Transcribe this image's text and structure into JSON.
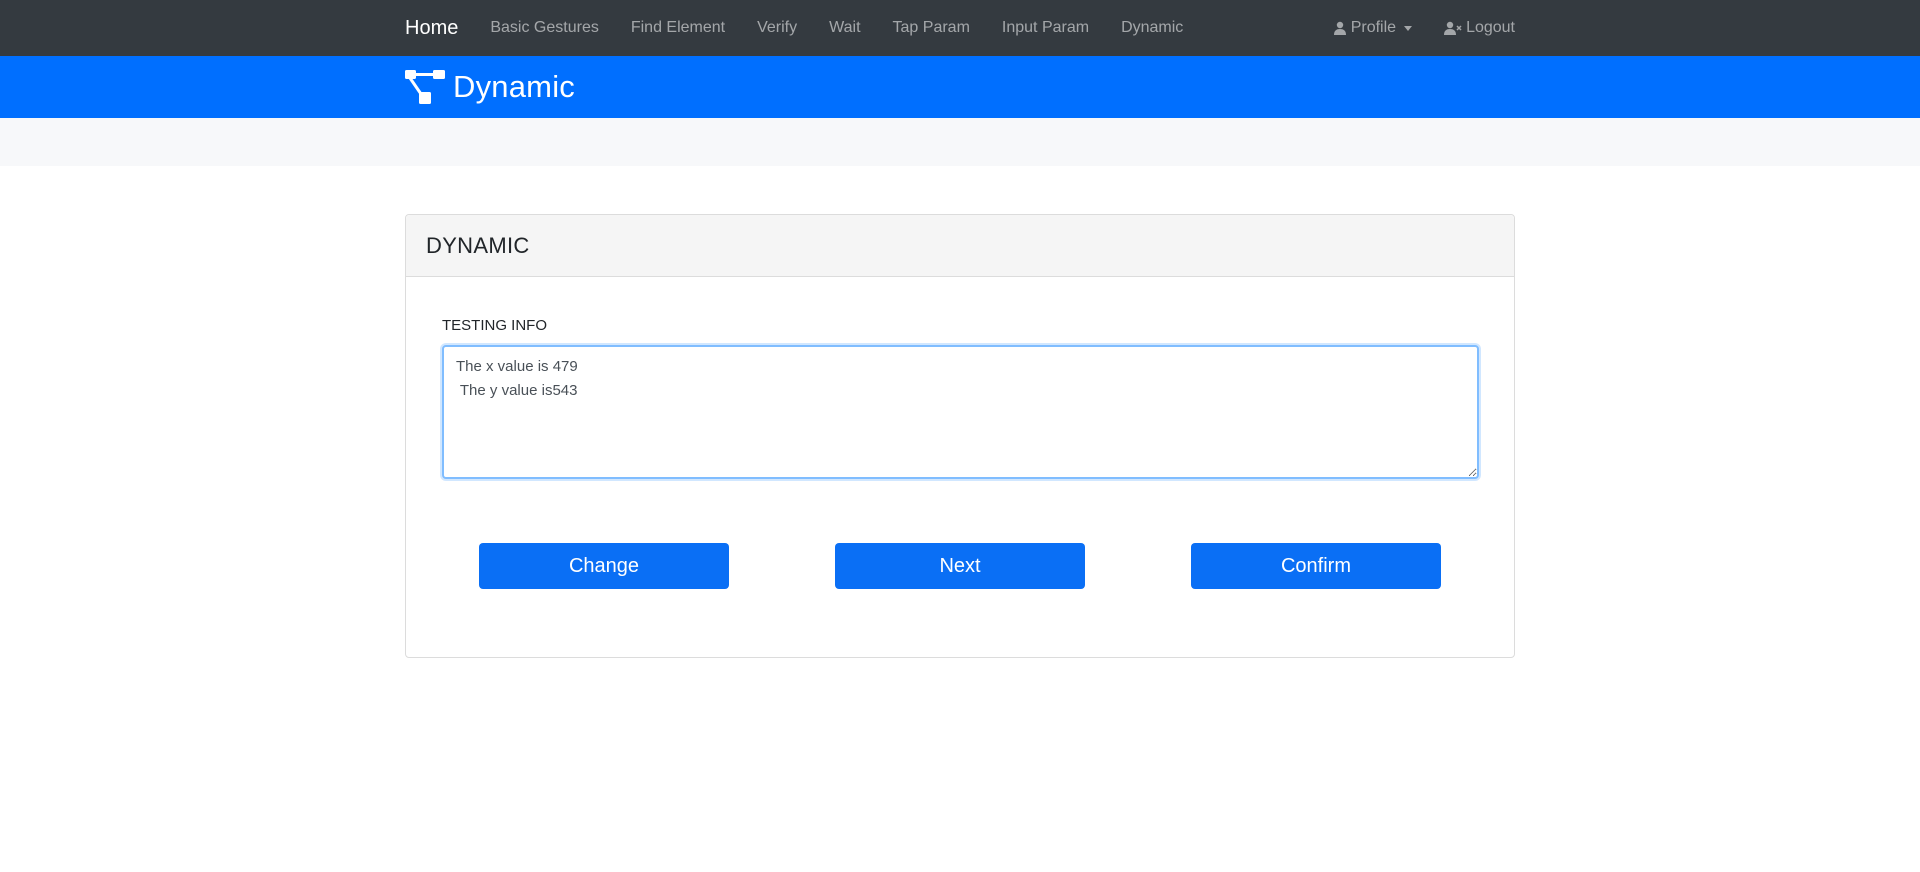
{
  "navbar": {
    "brand": "Home",
    "links": [
      "Basic Gestures",
      "Find Element",
      "Verify",
      "Wait",
      "Tap Param",
      "Input Param",
      "Dynamic"
    ],
    "profile": "Profile",
    "logout": "Logout",
    "profile_icon": "user-icon",
    "logout_icon": "user-remove-icon"
  },
  "banner": {
    "title": "Dynamic",
    "icon": "sitemap-icon"
  },
  "card": {
    "title": "DYNAMIC",
    "field_label": "TESTING INFO",
    "textarea_value": "The x value is 479\n The y value is543",
    "buttons": {
      "change": "Change",
      "next": "Next",
      "confirm": "Confirm"
    }
  },
  "colors": {
    "navbar_bg": "#343a40",
    "banner_bg": "#006fff",
    "button_bg": "#0a6ff5"
  }
}
